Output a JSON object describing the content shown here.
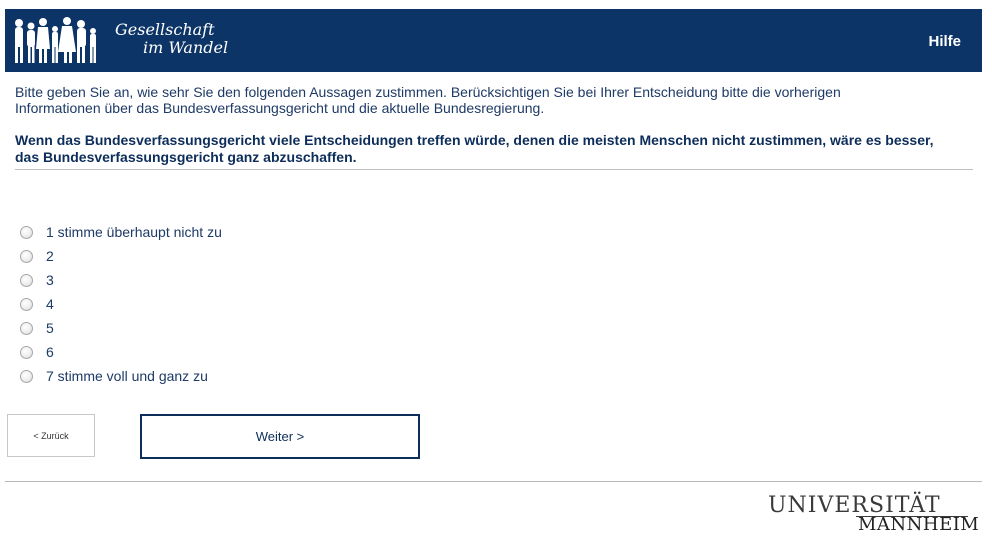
{
  "header": {
    "logo_line1": "Gesellschaft",
    "logo_line2": "im Wandel",
    "help_label": "Hilfe"
  },
  "intro_text": "Bitte geben Sie an, wie sehr Sie den folgenden Aussagen zustimmen. Berücksichtigen Sie bei Ihrer Entscheidung bitte die vorherigen Informationen über das Bundesverfassungsgericht und die aktuelle Bundesregierung.",
  "question_text": "Wenn das Bundesverfassungsgericht viele Entscheidungen treffen würde, denen die meisten Menschen nicht zustimmen, wäre es besser, das Bundesverfassungsgericht ganz abzuschaffen.",
  "options": [
    {
      "label": "1 stimme überhaupt nicht zu"
    },
    {
      "label": "2"
    },
    {
      "label": "3"
    },
    {
      "label": "4"
    },
    {
      "label": "5"
    },
    {
      "label": "6"
    },
    {
      "label": "7 stimme voll und ganz zu"
    }
  ],
  "buttons": {
    "back_label": "< Zurück",
    "next_label": "Weiter >"
  },
  "footer": {
    "uni_line1": "UNIVERSITÄT",
    "uni_line2": "MANNHEIM"
  },
  "colors": {
    "header_bg": "#0d3466",
    "text": "#1e3a66"
  }
}
